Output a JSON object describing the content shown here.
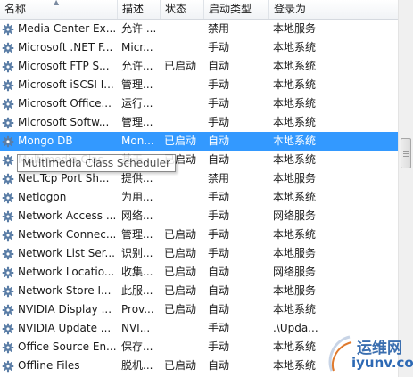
{
  "columns": [
    "名称",
    "描述",
    "状态",
    "启动类型",
    "登录为"
  ],
  "rows": [
    {
      "name": "Media Center Ex...",
      "desc": "允许 ...",
      "status": "",
      "start": "禁用",
      "logon": "本地服务"
    },
    {
      "name": "Microsoft .NET F...",
      "desc": "Micr...",
      "status": "",
      "start": "手动",
      "logon": "本地系统"
    },
    {
      "name": "Microsoft FTP S...",
      "desc": "允许...",
      "status": "已启动",
      "start": "自动",
      "logon": "本地系统"
    },
    {
      "name": "Microsoft iSCSI I...",
      "desc": "管理...",
      "status": "",
      "start": "手动",
      "logon": "本地系统"
    },
    {
      "name": "Microsoft Office...",
      "desc": "运行...",
      "status": "",
      "start": "手动",
      "logon": "本地系统"
    },
    {
      "name": "Microsoft Softw...",
      "desc": "管理...",
      "status": "",
      "start": "手动",
      "logon": "本地系统"
    },
    {
      "name": "Mongo DB",
      "desc": "Mon...",
      "status": "已启动",
      "start": "自动",
      "logon": "本地系统"
    },
    {
      "name": "Multimedia Clas...",
      "desc": "基于...",
      "status": "已启动",
      "start": "自动",
      "logon": "本地系统"
    },
    {
      "name": "Net.Tcp Port Sh...",
      "desc": "提供...",
      "status": "",
      "start": "禁用",
      "logon": "本地服务"
    },
    {
      "name": "Netlogon",
      "desc": "为用...",
      "status": "",
      "start": "手动",
      "logon": "本地系统"
    },
    {
      "name": "Network Access ...",
      "desc": "网络...",
      "status": "",
      "start": "手动",
      "logon": "网络服务"
    },
    {
      "name": "Network Connec...",
      "desc": "管理...",
      "status": "已启动",
      "start": "手动",
      "logon": "本地系统"
    },
    {
      "name": "Network List Ser...",
      "desc": "识别...",
      "status": "已启动",
      "start": "手动",
      "logon": "本地服务"
    },
    {
      "name": "Network Locatio...",
      "desc": "收集...",
      "status": "已启动",
      "start": "自动",
      "logon": "网络服务"
    },
    {
      "name": "Network Store I...",
      "desc": "此服...",
      "status": "已启动",
      "start": "自动",
      "logon": "本地服务"
    },
    {
      "name": "NVIDIA Display ...",
      "desc": "Prov...",
      "status": "已启动",
      "start": "自动",
      "logon": "本地系统"
    },
    {
      "name": "NVIDIA Update ...",
      "desc": "NVI...",
      "status": "",
      "start": "手动",
      "logon": ".\\Upda..."
    },
    {
      "name": "Office Source En...",
      "desc": "保存...",
      "status": "",
      "start": "手动",
      "logon": "本地系统"
    },
    {
      "name": "Offline Files",
      "desc": "脱机...",
      "status": "已启动",
      "start": "自动",
      "logon": "本地系统"
    }
  ],
  "selected_row": 6,
  "tooltip": "Multimedia Class Scheduler",
  "watermark": {
    "cn": "运维网",
    "url": "iyunv.com"
  },
  "colors": {
    "selection": "#3399ff",
    "gear": "#5a7da6"
  }
}
